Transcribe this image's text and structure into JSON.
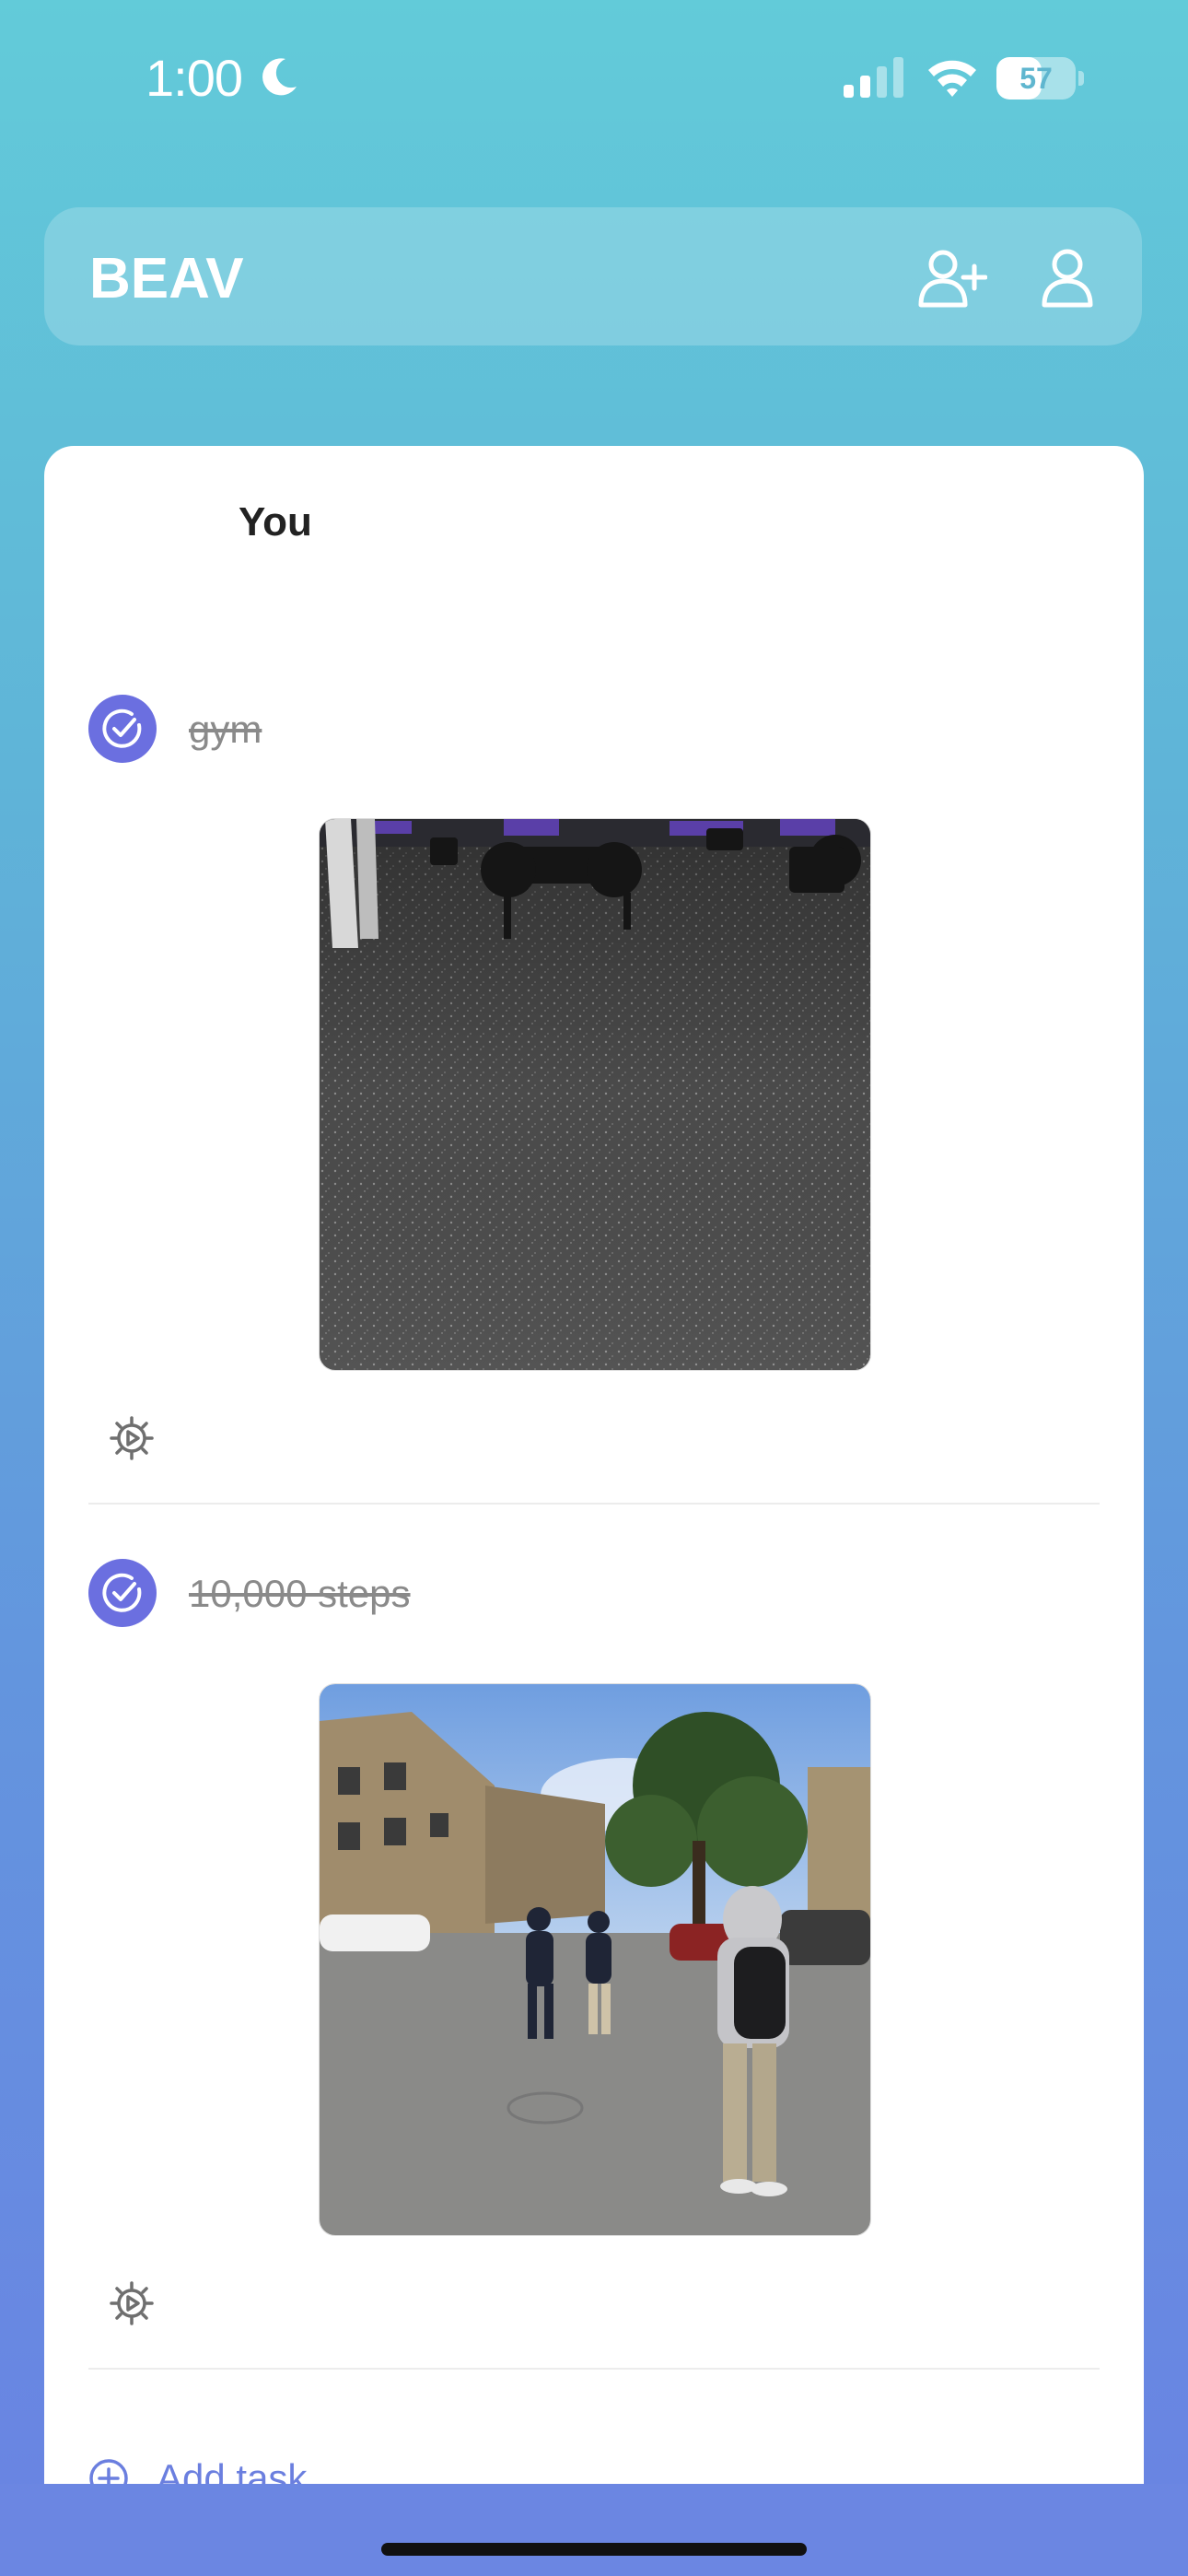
{
  "status_bar": {
    "time": "1:00",
    "battery": "57",
    "battery_level": 0.57
  },
  "header": {
    "title": "BEAV"
  },
  "card": {
    "owner": "You",
    "tasks": [
      {
        "title": "gym",
        "completed": true
      },
      {
        "title": "10,000 steps",
        "completed": true
      }
    ],
    "add_task_label": "Add task"
  },
  "colors": {
    "accent": "#6b6fe0",
    "link": "#6b7fdf"
  }
}
